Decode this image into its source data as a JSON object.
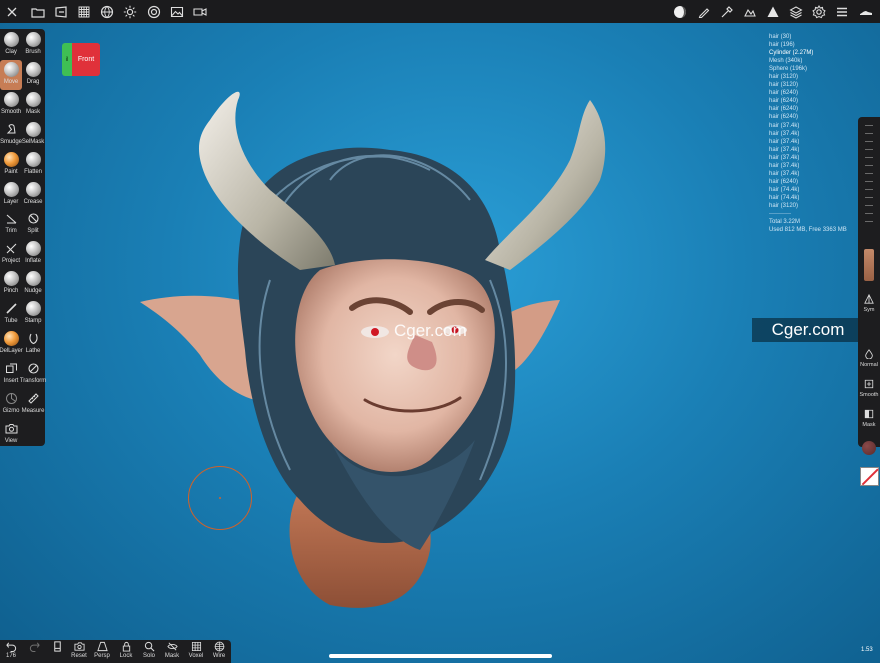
{
  "topbar": {
    "left_icons": [
      "tools-icon",
      "folder-icon",
      "import-icon",
      "grid-icon",
      "globe-icon",
      "sun-icon",
      "target-icon",
      "image-icon",
      "video-icon"
    ],
    "right_icons": [
      "material-ball-icon",
      "pen-icon",
      "picker-icon",
      "scene-hand-icon",
      "triangle-icon",
      "layers-icon",
      "settings-icon",
      "menu-icon",
      "shoe-icon"
    ]
  },
  "left_tools": [
    {
      "label": "Clay",
      "icon": "sphere-icon"
    },
    {
      "label": "Brush",
      "icon": "sphere-icon"
    },
    {
      "label": "Move",
      "icon": "sphere-icon",
      "active": true
    },
    {
      "label": "Drag",
      "icon": "sphere-icon"
    },
    {
      "label": "Smooth",
      "icon": "sphere-icon"
    },
    {
      "label": "Mask",
      "icon": "sphere-icon"
    },
    {
      "label": "Smudge",
      "icon": "smudge-icon"
    },
    {
      "label": "SelMask",
      "icon": "sphere-icon"
    },
    {
      "label": "Paint",
      "icon": "paint-sphere-icon"
    },
    {
      "label": "Flatten",
      "icon": "sphere-icon"
    },
    {
      "label": "Layer",
      "icon": "sphere-icon"
    },
    {
      "label": "Crease",
      "icon": "sphere-icon"
    },
    {
      "label": "Trim",
      "icon": "trim-icon"
    },
    {
      "label": "Split",
      "icon": "split-icon"
    },
    {
      "label": "Project",
      "icon": "project-icon"
    },
    {
      "label": "Inflate",
      "icon": "sphere-icon"
    },
    {
      "label": "Pinch",
      "icon": "sphere-icon"
    },
    {
      "label": "Nudge",
      "icon": "sphere-icon"
    },
    {
      "label": "Tube",
      "icon": "tube-icon"
    },
    {
      "label": "Stamp",
      "icon": "sphere-icon"
    },
    {
      "label": "DelLayer",
      "icon": "paint-sphere-icon"
    },
    {
      "label": "Lathe",
      "icon": "lathe-icon"
    },
    {
      "label": "Insert",
      "icon": "insert-icon"
    },
    {
      "label": "Transform",
      "icon": "transform-icon"
    },
    {
      "label": "Gizmo",
      "icon": "gizmo-icon"
    },
    {
      "label": "Measure",
      "icon": "ruler-icon"
    },
    {
      "label": "View",
      "icon": "camera-icon"
    }
  ],
  "viewcube": {
    "side": "il",
    "front": "Front"
  },
  "scene_list": {
    "items": [
      "hair (30)",
      "hair (196)",
      "Cylinder (2.27M)",
      "Mesh (340k)",
      "Sphere (196k)",
      "hair (3120)",
      "hair (3120)",
      "hair (6240)",
      "hair (6240)",
      "hair (6240)",
      "hair (6240)",
      "hair (37.4k)",
      "hair (37.4k)",
      "hair (37.4k)",
      "hair (37.4k)",
      "hair (37.4k)",
      "hair (37.4k)",
      "hair (37.4k)",
      "hair (6240)",
      "hair (74.4k)",
      "hair (74.4k)",
      "hair (3120)"
    ],
    "selected_index": 2,
    "separator": "-----------",
    "total": "Total 3.22M",
    "memory": "Used 812 MB, Free 3363 MB"
  },
  "right_tools": [
    {
      "label": "Sym",
      "icon": "symmetry-icon"
    },
    {
      "label": "Normal",
      "icon": "drop-icon"
    },
    {
      "label": "Smooth",
      "icon": "plus-box-icon"
    },
    {
      "label": "Mask",
      "icon": "half-box-icon"
    }
  ],
  "watermark": {
    "center": "Cger.com",
    "right": "Cger.com"
  },
  "bottom_tools": [
    {
      "label": "",
      "icon": "undo-icon"
    },
    {
      "label": "",
      "icon": "redo-icon"
    },
    {
      "label": "",
      "icon": "history-icon"
    },
    {
      "label": "Reset",
      "icon": "reset-camera-icon"
    },
    {
      "label": "Persp",
      "icon": "perspective-icon"
    },
    {
      "label": "Lock",
      "icon": "lock-icon"
    },
    {
      "label": "Solo",
      "icon": "search-icon"
    },
    {
      "label": "Mask",
      "icon": "eye-slash-icon"
    },
    {
      "label": "Voxel",
      "icon": "voxel-grid-icon"
    },
    {
      "label": "Wire",
      "icon": "wireframe-globe-icon"
    }
  ],
  "undo_count": "176",
  "fps": "1.53",
  "colors": {
    "accent": "#c77d55",
    "front": "#e0313a",
    "side": "#3fbf54",
    "background": "#1a7fb5"
  }
}
